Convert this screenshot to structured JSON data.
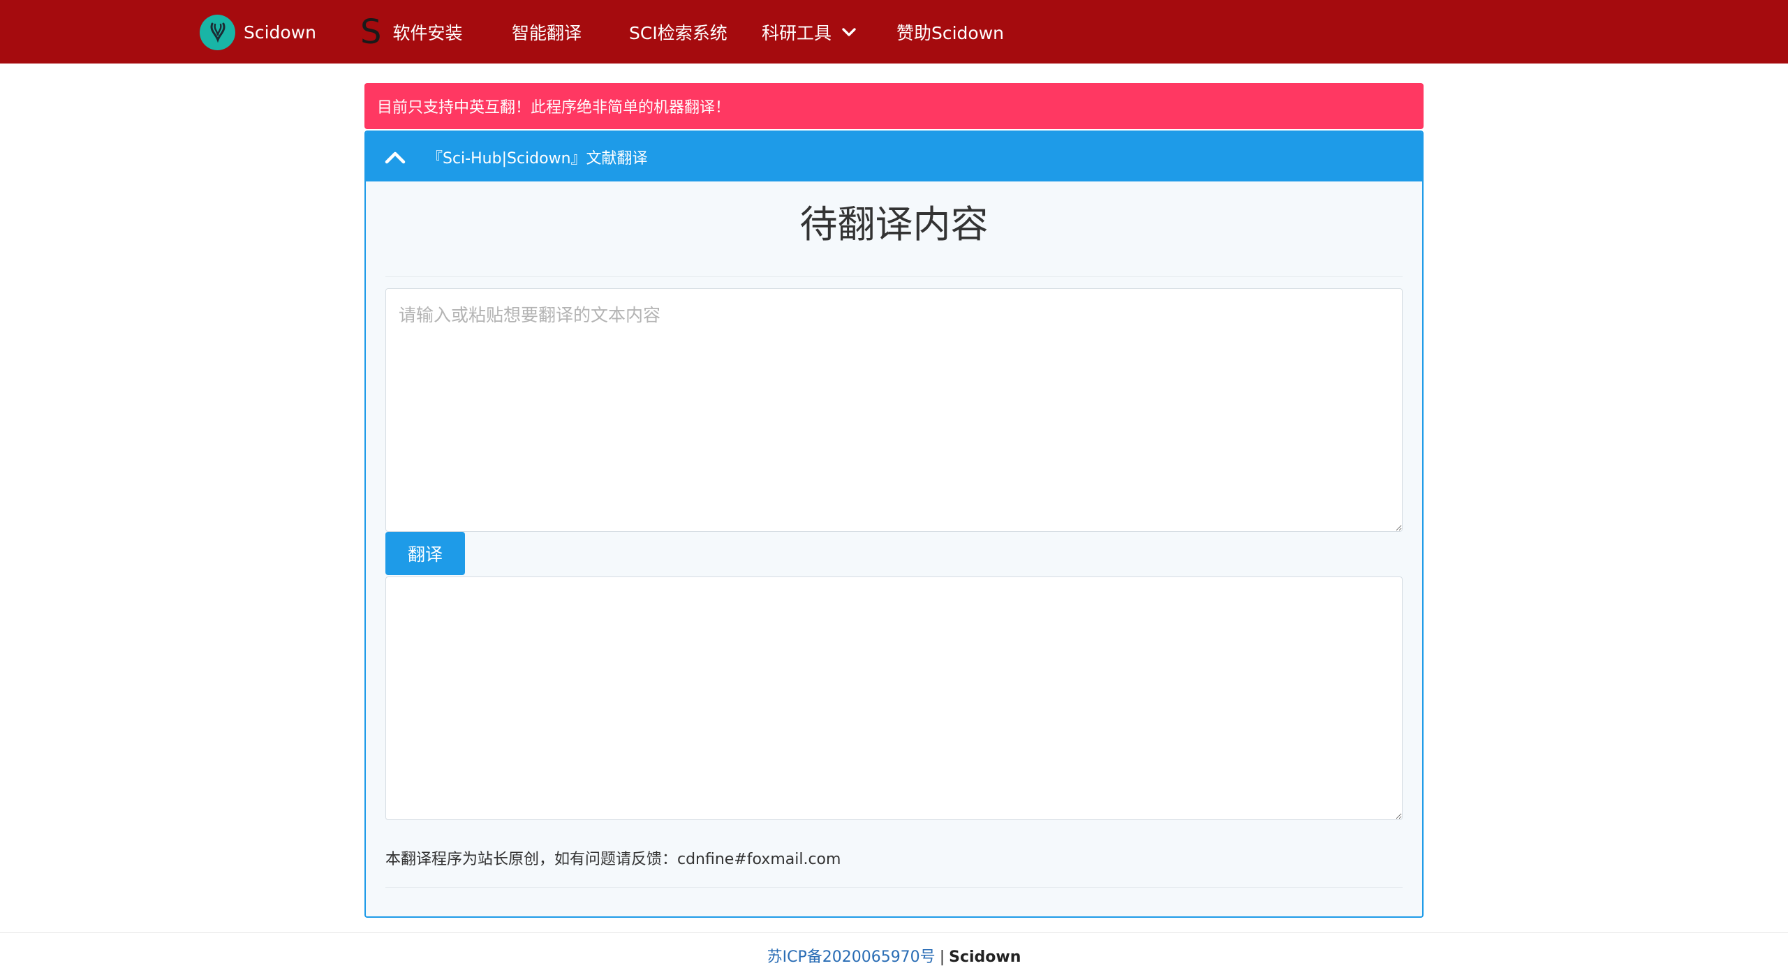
{
  "navbar": {
    "brand": "Scidown",
    "items": [
      {
        "label": "软件安装"
      },
      {
        "label": "智能翻译"
      },
      {
        "label": "SCI检索系统"
      },
      {
        "label": "科研工具"
      },
      {
        "label": "赞助Scidown"
      }
    ]
  },
  "alert": {
    "text": "目前只支持中英互翻！此程序绝非简单的机器翻译！"
  },
  "panel": {
    "title": "『Sci-Hub|Scidown』文献翻译",
    "heading": "待翻译内容",
    "source_placeholder": "请输入或粘贴想要翻译的文本内容",
    "source_value": "",
    "result_value": "",
    "translate_label": "翻译",
    "note": "本翻译程序为站长原创，如有问题请反馈：cdnfine#foxmail.com"
  },
  "footer": {
    "icp": "苏ICP备2020065970号",
    "separator": "|",
    "site": "Scidown"
  },
  "colors": {
    "navbar": "#a50b0e",
    "alert": "#ff3862",
    "primary": "#1e9be8",
    "logo": "#19b5a6"
  },
  "icons": {
    "brand": "scidown-logo-icon",
    "nav_prefix": "s-letter-icon",
    "dropdown": "chevron-down-icon",
    "collapse": "chevron-up-icon"
  }
}
